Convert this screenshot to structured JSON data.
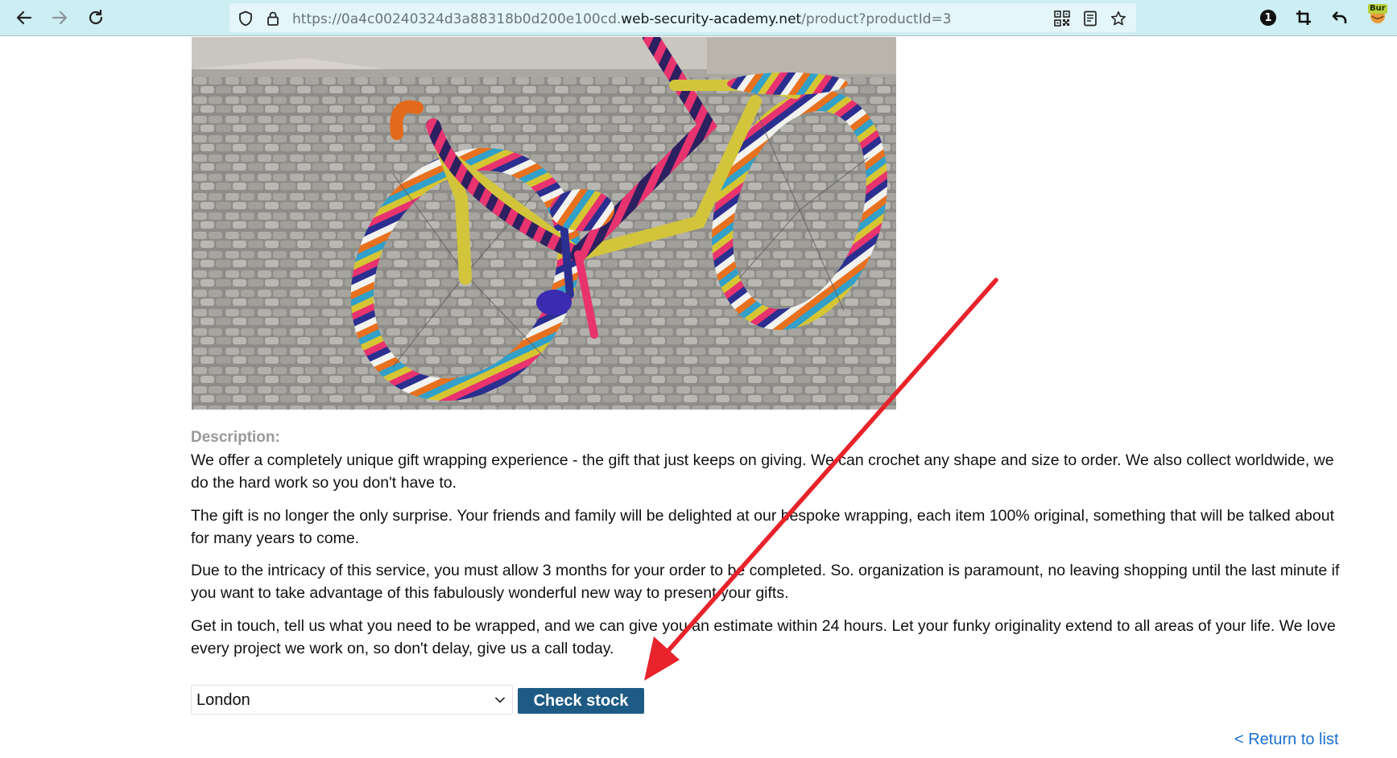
{
  "browser": {
    "url_prefix": "https://0a4c00240324d3a88318b0d200e100cd.",
    "url_host": "web-security-academy.net",
    "url_path": "/product?productId=3",
    "notification_count": "1",
    "burp_extension_label": "Bur",
    "icons": {
      "back": "back-arrow-icon",
      "forward": "forward-arrow-icon",
      "reload": "reload-icon",
      "security": "shield-icon",
      "lock": "lock-icon",
      "qr": "qr-code-icon",
      "reader": "reader-mode-icon",
      "bookmark": "star-icon",
      "crop": "crop-icon",
      "undo": "undo-icon"
    }
  },
  "product": {
    "description_heading": "Description:",
    "paragraphs": [
      "We offer a completely unique gift wrapping experience - the gift that just keeps on giving. We can crochet any shape and size to order. We also collect worldwide, we do the hard work so you don't have to.",
      "The gift is no longer the only surprise. Your friends and family will be delighted at our bespoke wrapping, each item 100% original, something that will be talked about for many years to come.",
      "Due to the intricacy of this service, you must allow 3 months for your order to be completed. So. organization is paramount, no leaving shopping until the last minute if you want to take advantage of this fabulously wonderful new way to present your gifts.",
      "Get in touch, tell us what you need to be wrapped, and we can give you an estimate within 24 hours. Let your funky originality extend to all areas of your life. We love every project we work on, so don't delay, give us a call today."
    ]
  },
  "stock": {
    "selected_store": "London",
    "check_button_label": "Check stock"
  },
  "footer": {
    "return_link_label": "< Return to list"
  },
  "colors": {
    "toolbar_bg": "#cdeef3",
    "button_bg": "#1e5b84",
    "link": "#1a6fd1",
    "annotation_arrow": "#e8232b"
  }
}
